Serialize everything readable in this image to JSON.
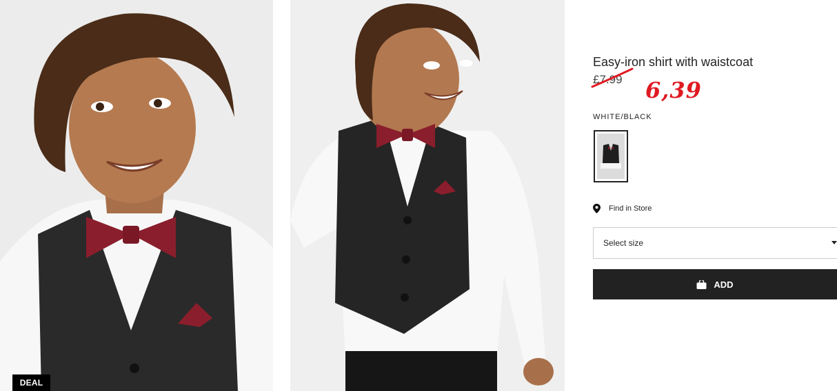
{
  "gallery": {
    "deal_label": "DEAL"
  },
  "product": {
    "title": "Easy-iron shirt with waistcoat",
    "old_price": "£7.99",
    "new_price": "6,39",
    "color_name": "WHITE/BLACK"
  },
  "actions": {
    "find_store_label": "Find in Store",
    "size_select_label": "Select size",
    "add_label": "ADD"
  },
  "icons": {
    "location": "map-pin-icon",
    "dropdown": "chevron-down-icon",
    "bag": "shopping-bag-icon"
  },
  "colors": {
    "new_price": "#e01a22",
    "add_button": "#222222"
  }
}
